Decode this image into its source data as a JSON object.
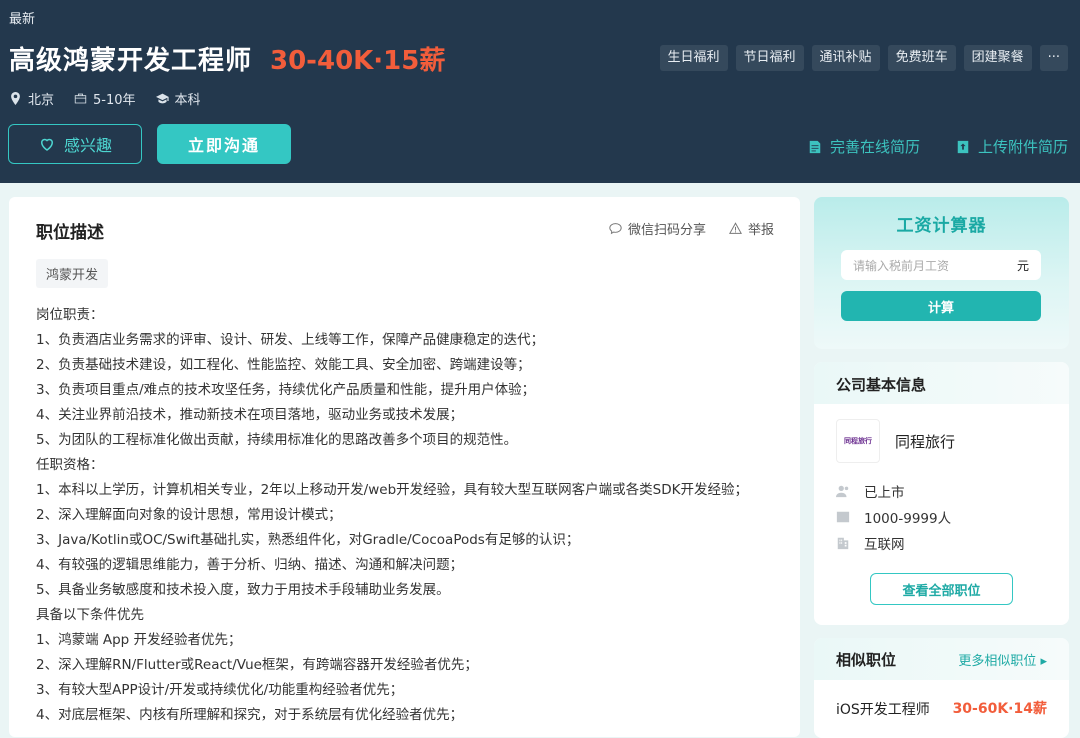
{
  "header": {
    "badge": "最新",
    "title": "高级鸿蒙开发工程师",
    "salary": "30-40K·15薪",
    "benefits": [
      "生日福利",
      "节日福利",
      "通讯补贴",
      "免费班车",
      "团建聚餐",
      "···"
    ],
    "meta": {
      "city": "北京",
      "experience": "5-10年",
      "degree": "本科"
    },
    "interest_label": "感兴趣",
    "chat_label": "立即沟通",
    "resume_online": "完善在线简历",
    "resume_upload": "上传附件简历"
  },
  "main": {
    "title": "职位描述",
    "share": "微信扫码分享",
    "report": "举报",
    "tag": "鸿蒙开发",
    "lines": [
      "岗位职责：",
      "1、负责酒店业务需求的评审、设计、研发、上线等工作，保障产品健康稳定的迭代；",
      "2、负责基础技术建设，如工程化、性能监控、效能工具、安全加密、跨端建设等；",
      "3、负责项目重点/难点的技术攻坚任务，持续优化产品质量和性能，提升用户体验；",
      "4、关注业界前沿技术，推动新技术在项目落地，驱动业务或技术发展；",
      "5、为团队的工程标准化做出贡献，持续用标准化的思路改善多个项目的规范性。",
      "任职资格：",
      "1、本科以上学历，计算机相关专业，2年以上移动开发/web开发经验，具有较大型互联网客户端或各类SDK开发经验；",
      "2、深入理解面向对象的设计思想，常用设计模式；",
      "3、Java/Kotlin或OC/Swift基础扎实，熟悉组件化，对Gradle/CocoaPods有足够的认识；",
      "4、有较强的逻辑思维能力，善于分析、归纳、描述、沟通和解决问题；",
      "5、具备业务敏感度和技术投入度，致力于用技术手段辅助业务发展。",
      "具备以下条件优先",
      "1、鸿蒙端 App 开发经验者优先；",
      "2、深入理解RN/Flutter或React/Vue框架，有跨端容器开发经验者优先；",
      "3、有较大型APP设计/开发或持续优化/功能重构经验者优先；",
      "4、对底层框架、内核有所理解和探究，对于系统层有优化经验者优先；"
    ]
  },
  "calculator": {
    "title": "工资计算器",
    "placeholder": "请输入税前月工资",
    "unit": "元",
    "button": "计算"
  },
  "company": {
    "heading": "公司基本信息",
    "logo_text": "同程旅行",
    "name": "同程旅行",
    "stage": "已上市",
    "size": "1000-9999人",
    "industry": "互联网",
    "all_jobs": "查看全部职位"
  },
  "similar": {
    "heading": "相似职位",
    "more": "更多相似职位 ▸",
    "job_title": "iOS开发工程师",
    "job_salary": "30-60K·14薪"
  },
  "colors": {
    "header_bg": "#23384d",
    "accent": "#34c7c3",
    "salary": "#f25d3b"
  }
}
